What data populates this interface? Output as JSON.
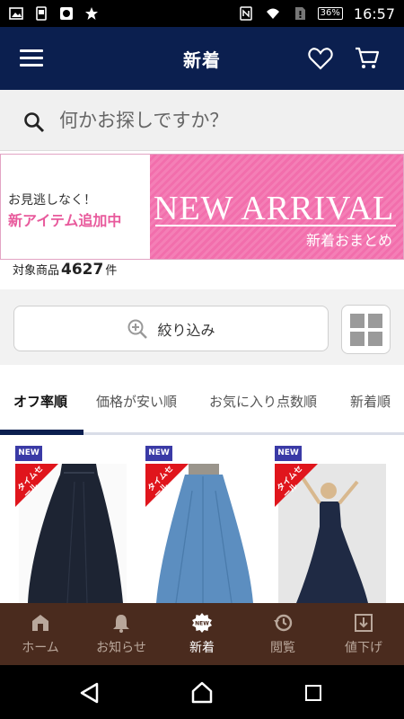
{
  "status_bar": {
    "time": "16:57",
    "battery": "36%"
  },
  "header": {
    "title": "新着"
  },
  "search": {
    "placeholder": "何かお探しですか？"
  },
  "banner": {
    "small_text": "お見逃しなく！",
    "big_text": "新アイテム追加中",
    "title": "NEW ARRIVAL",
    "subtitle": "新着おまとめ"
  },
  "result": {
    "prefix": "対象商品",
    "count": "4627",
    "suffix": "件"
  },
  "filter": {
    "label": "絞り込み"
  },
  "tabs": [
    {
      "label": "オフ率順"
    },
    {
      "label": "価格が安い順"
    },
    {
      "label": "お気に入り点数順"
    },
    {
      "label": "新着順"
    }
  ],
  "products": [
    {
      "badge": "NEW",
      "sale": "タイムセール"
    },
    {
      "badge": "NEW",
      "sale": "タイムセール"
    },
    {
      "badge": "NEW",
      "sale": "タイムセール"
    }
  ],
  "bottom_nav": [
    {
      "label": "ホーム",
      "icon": "house-icon"
    },
    {
      "label": "お知らせ",
      "icon": "bell-icon"
    },
    {
      "label": "新着",
      "icon": "new-badge-icon",
      "badge_text": "NEW"
    },
    {
      "label": "閲覧",
      "icon": "history-icon"
    },
    {
      "label": "値下げ",
      "icon": "price-down-icon"
    }
  ],
  "colors": {
    "header": "#0b1f4f",
    "bottom_nav": "#4a2b1e",
    "sale": "#e0151c",
    "new_badge": "#3a3aa6",
    "banner_pink": "#f47fb6"
  }
}
